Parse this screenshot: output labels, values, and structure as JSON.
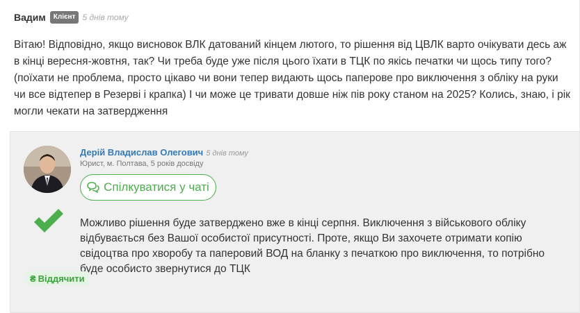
{
  "question": {
    "author": "Вадим",
    "badge": "Клієнт",
    "time": "5 днів тому",
    "text": "Вітаю! Відповідно, якщо висновок ВЛК датований кінцем лютого, то рішення від ЦВЛК варто очікувати десь аж в кінці вересня-жовтня, так? Чи треба буде уже після цього їхати в ТЦК по якісь печатки чи щось типу того? (поїхати не проблема, просто цікаво чи вони тепер видають щось паперове про виключення з обліку на руки чи все відтепер в Резерві і крапка) І чи може це тривати довше ніж пів року станом на 2025? Колись, знаю, і рік могли чекати на затвердження"
  },
  "answer": {
    "author": "Дерій Владислав Олегович",
    "time": "5 днів тому",
    "subtitle": "Юрист, м. Полтава, 5 років досвіду",
    "chat_button": "Спілкуватися у чаті",
    "text": "Можливо рішення буде затверджено вже в кінці серпня. Виключення з військового обліку відбувається без Вашої особистої присутності. Проте, якщо Ви захочете отримати копію свідоцтва про хворобу та паперовий ВОД на бланку з печаткою про виключення, то потрібно буде особисто звернутися до ТЦК",
    "thanks_button": "Віддячити",
    "icons": {
      "chat": "comments-icon",
      "accepted": "checkmark-icon",
      "thanks": "hryvnia-icon"
    }
  },
  "colors": {
    "accent_green": "#4cae4c",
    "link_blue": "#337ab7",
    "badge_grey": "#777777"
  }
}
